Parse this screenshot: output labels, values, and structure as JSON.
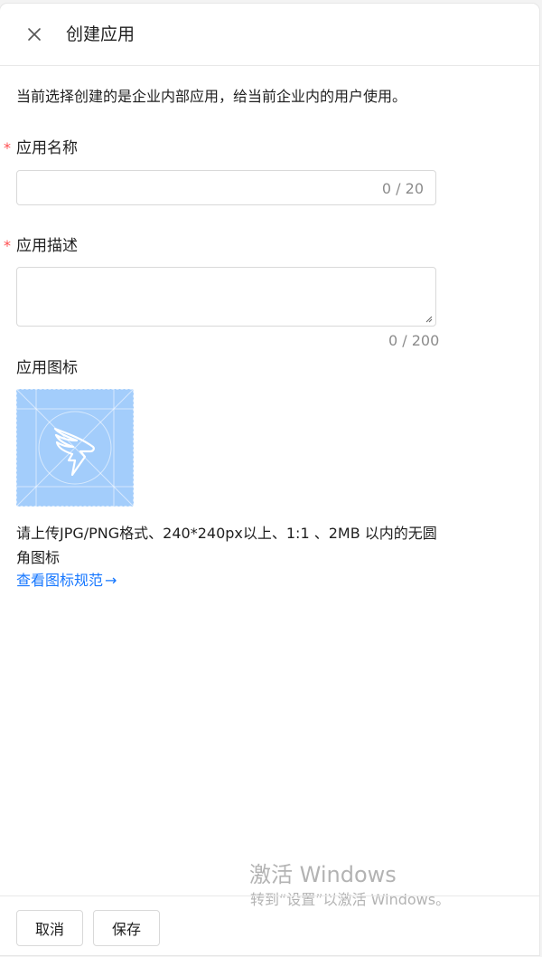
{
  "header": {
    "close_icon": "close-icon",
    "title": "创建应用"
  },
  "description": "当前选择创建的是企业内部应用，给当前企业内的用户使用。",
  "form": {
    "name": {
      "required_mark": "*",
      "label": "应用名称",
      "value": "",
      "counter": "0 / 20"
    },
    "desc": {
      "required_mark": "*",
      "label": "应用描述",
      "value": "",
      "counter": "0 / 200"
    },
    "icon": {
      "label": "应用图标",
      "placeholder_icon": "dingtalk-logo-icon",
      "hint": "请上传JPG/PNG格式、240*240px以上、1:1 、2MB 以内的无圆角图标",
      "link_text": "查看图标规范",
      "link_arrow": "→"
    }
  },
  "watermark": {
    "line1": "激活 Windows",
    "line2": "转到“设置”以激活 Windows。"
  },
  "footer": {
    "cancel_label": "取消",
    "save_label": "保存"
  },
  "colors": {
    "required": "#ff4d4f",
    "link": "#1677ff",
    "icon_bg": "#a3cdfb"
  }
}
